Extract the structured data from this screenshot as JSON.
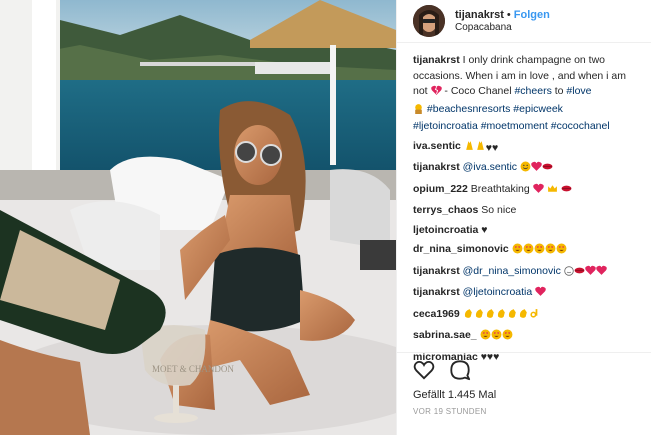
{
  "post": {
    "username": "tijanakrst",
    "follow_label": "Folgen",
    "location": "Copacabana"
  },
  "caption": {
    "user": "tijanakrst",
    "text_1": " I only drink champagne on two occasions. When i am in love , and when i am not ",
    "text_2": " - Coco Chanel ",
    "tags_1": "#cheers",
    "text_3": " to ",
    "tags_2": "#love",
    "tags_3": "#beachesnresorts #epicweek",
    "tags_4": "#ljetoincroatia #moetmoment #cocochanel"
  },
  "comments": [
    {
      "user": "iva.sentic",
      "text": ""
    },
    {
      "user": "tijanakrst",
      "mention": "@iva.sentic",
      "text": ""
    },
    {
      "user": "opium_222",
      "text": " Breathtaking "
    },
    {
      "user": "terrys_chaos",
      "text": " So nice"
    },
    {
      "user": "ljetoincroatia",
      "text": " ♥"
    },
    {
      "user": "dr_nina_simonovic",
      "text": ""
    },
    {
      "user": "tijanakrst",
      "mention": "@dr_nina_simonovic",
      "text": ""
    },
    {
      "user": "tijanakrst",
      "mention": "@ljetoincroatia",
      "text": ""
    },
    {
      "user": "ceca1969",
      "text": ""
    },
    {
      "user": "sabrina.sae_",
      "text": ""
    },
    {
      "user": "micromaniac",
      "text": " ♥♥♥"
    }
  ],
  "actions": {
    "like_icon": "heart-icon",
    "comment_icon": "comment-icon",
    "likes_text": "Gefällt 1.445 Mal",
    "time_text": "VOR 19 STUNDEN"
  },
  "colors": {
    "link_blue": "#3897f0",
    "hashtag": "#003569",
    "emoji_red": "#e0245e",
    "emoji_yellow": "#f5b800"
  }
}
